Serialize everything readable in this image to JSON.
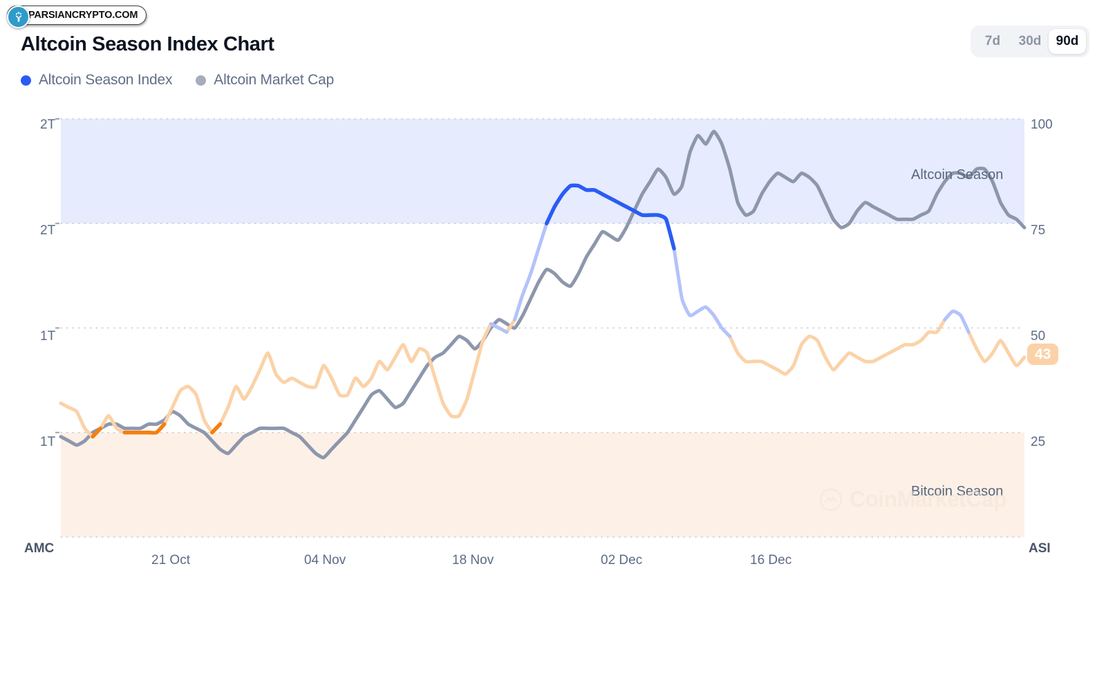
{
  "watermark_badge": {
    "site": "PARSIANCRYPTO.COM",
    "logo_icon": "parsian-plant-logo-icon"
  },
  "header": {
    "title": "Altcoin Season Index Chart"
  },
  "range_switch": {
    "options": [
      "7d",
      "30d",
      "90d"
    ],
    "selected": "90d"
  },
  "legend": [
    {
      "label": "Altcoin Season Index",
      "color": "#2a5cf5",
      "dot_icon": "legend-dot-icon"
    },
    {
      "label": "Altcoin Market Cap",
      "color": "#a6adbb",
      "dot_icon": "legend-dot-icon"
    }
  ],
  "chart_data": {
    "type": "line",
    "title": "Altcoin Season Index Chart",
    "xlabel": "",
    "ylabel": "",
    "grid": true,
    "legend_position": "top-left",
    "x_tick_labels": [
      "21 Oct",
      "04 Nov",
      "18 Nov",
      "02 Dec",
      "16 Dec"
    ],
    "left_axis": {
      "name": "AMC",
      "title": "Altcoin Market Cap",
      "tick_labels": [
        "2T",
        "2T",
        "1T",
        "1T"
      ],
      "tick_values": [
        2.0,
        1.75,
        1.5,
        1.25
      ],
      "unit": "USD"
    },
    "right_axis": {
      "name": "ASI",
      "title": "Altcoin Season Index",
      "tick_labels": [
        "100",
        "75",
        "50",
        "25"
      ],
      "ylim": [
        0,
        100
      ]
    },
    "zones": [
      {
        "label": "Altcoin Season",
        "from": 75,
        "to": 100,
        "fill": "#e6ebfd",
        "text_color": "#58667e"
      },
      {
        "label": "Bitcoin Season",
        "from": 0,
        "to": 25,
        "fill": "#fdf0e6",
        "text_color": "#58667e"
      }
    ],
    "current_value_badge": {
      "value": "43",
      "axis": "right",
      "color": "#fbd2a8"
    },
    "colors": {
      "asi_altcoin_season": "#2a5cf5",
      "asi_neutral_high": "#b4c2fb",
      "asi_neutral_low": "#fbd2a8",
      "asi_bitcoin_season": "#f4800f",
      "amc_line": "#8d97ac"
    },
    "series": [
      {
        "name": "Altcoin Season Index",
        "axis": "right",
        "values": [
          32,
          31,
          30,
          26,
          24,
          26,
          29,
          26,
          25,
          25,
          25,
          25,
          25,
          27,
          31,
          35,
          36,
          34,
          28,
          25,
          27,
          31,
          36,
          33,
          36,
          40,
          44,
          39,
          37,
          38,
          37,
          36,
          36,
          41,
          38,
          34,
          34,
          38,
          36,
          38,
          42,
          40,
          43,
          46,
          42,
          45,
          44,
          38,
          32,
          29,
          29,
          33,
          40,
          47,
          51,
          50,
          49,
          52,
          58,
          63,
          69,
          75,
          79,
          82,
          84,
          84,
          83,
          83,
          82,
          81,
          80,
          79,
          78,
          77,
          77,
          77,
          76,
          69,
          57,
          53,
          54,
          55,
          53,
          50,
          48,
          44,
          42,
          42,
          42,
          41,
          40,
          39,
          41,
          46,
          48,
          47,
          43,
          40,
          42,
          44,
          43,
          42,
          42,
          43,
          44,
          45,
          46,
          46,
          47,
          49,
          49,
          52,
          54,
          53,
          49,
          45,
          42,
          44,
          47,
          44,
          41,
          43
        ]
      },
      {
        "name": "Altcoin Market Cap",
        "axis": "left",
        "values": [
          24,
          23,
          22,
          23,
          25,
          26,
          27,
          27,
          26,
          26,
          26,
          27,
          27,
          28,
          30,
          29,
          27,
          26,
          25,
          23,
          21,
          20,
          22,
          24,
          25,
          26,
          26,
          26,
          26,
          25,
          24,
          22,
          20,
          19,
          21,
          23,
          25,
          28,
          31,
          34,
          35,
          33,
          31,
          32,
          35,
          38,
          41,
          43,
          44,
          46,
          48,
          47,
          45,
          47,
          50,
          52,
          51,
          50,
          53,
          57,
          61,
          64,
          63,
          61,
          60,
          63,
          67,
          70,
          73,
          72,
          71,
          74,
          78,
          82,
          85,
          88,
          86,
          82,
          84,
          92,
          96,
          94,
          97,
          94,
          88,
          80,
          77,
          78,
          82,
          85,
          87,
          86,
          85,
          87,
          86,
          84,
          80,
          76,
          74,
          75,
          78,
          80,
          79,
          78,
          77,
          76,
          76,
          76,
          77,
          78,
          82,
          85,
          87,
          87,
          86,
          88,
          88,
          85,
          80,
          77,
          76,
          74
        ]
      }
    ]
  }
}
